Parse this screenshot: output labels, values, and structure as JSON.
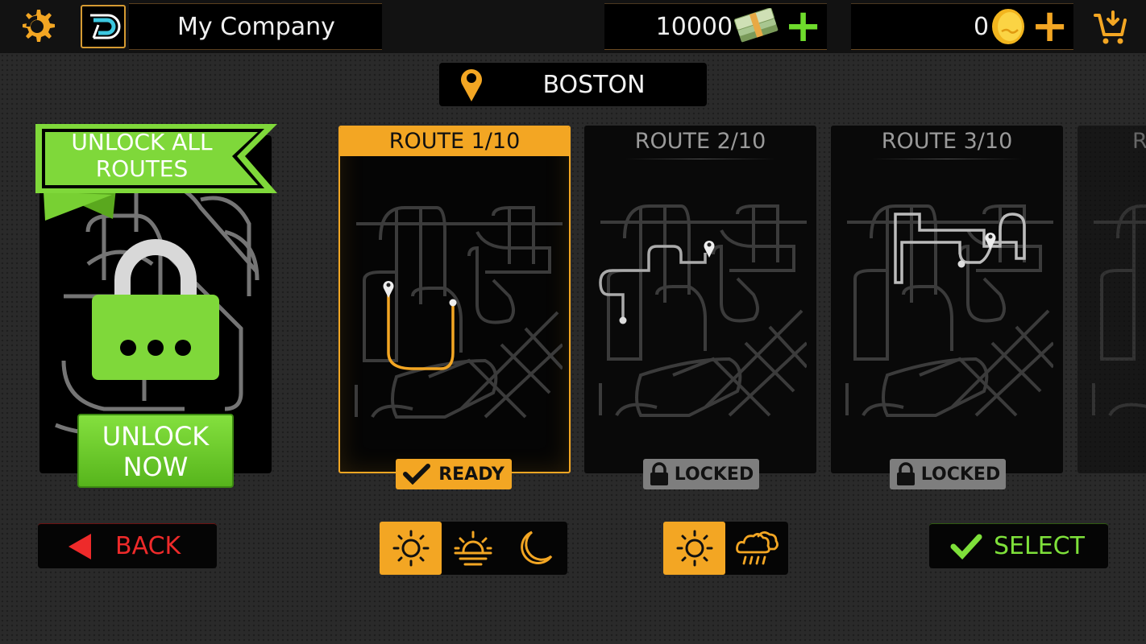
{
  "header": {
    "company_name": "My Company",
    "cash_amount": "10000",
    "coin_amount": "0",
    "plus_symbol": "+"
  },
  "city": {
    "name": "BOSTON"
  },
  "unlock_panel": {
    "ribbon_line1": "UNLOCK ALL",
    "ribbon_line2": "ROUTES",
    "button_line1": "UNLOCK",
    "button_line2": "NOW"
  },
  "routes": [
    {
      "title": "ROUTE 1/10",
      "status": "READY",
      "state": "selected"
    },
    {
      "title": "ROUTE 2/10",
      "status": "LOCKED",
      "state": "locked"
    },
    {
      "title": "ROUTE 3/10",
      "status": "LOCKED",
      "state": "locked"
    },
    {
      "title": "R",
      "status": "",
      "state": "partial"
    }
  ],
  "controls": {
    "back_label": "BACK",
    "select_label": "SELECT",
    "time_of_day": [
      {
        "name": "day",
        "selected": true
      },
      {
        "name": "sunset",
        "selected": false
      },
      {
        "name": "night",
        "selected": false
      }
    ],
    "weather": [
      {
        "name": "clear",
        "selected": true
      },
      {
        "name": "rain",
        "selected": false
      }
    ]
  },
  "colors": {
    "accent_orange": "#f3a623",
    "accent_green": "#7ee03a",
    "back_red": "#ee2a2a",
    "locked_gray": "#7e7e7e"
  }
}
